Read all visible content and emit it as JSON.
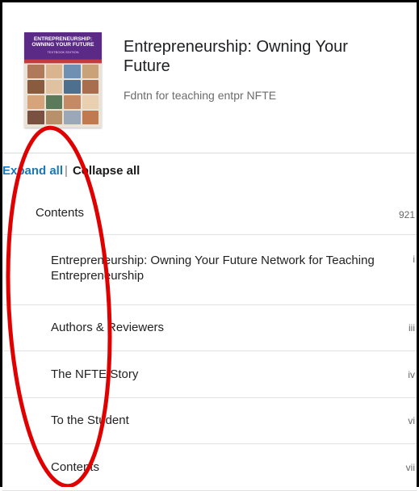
{
  "book": {
    "cover": {
      "title": "ENTREPRENEURSHIP:\nOWNING YOUR FUTURE",
      "subtitle": "TEXTBOOK EDITION",
      "colors": {
        "band": "#5b2a86",
        "stripe": "#c43b3b"
      }
    },
    "title": "Entrepreneurship: Owning Your Future",
    "author": "Fdntn for teaching entpr NFTE"
  },
  "controls": {
    "expand_all": "Expand all",
    "separator": "|",
    "collapse_all": "Collapse all"
  },
  "toc": {
    "header": {
      "label": "Contents",
      "page": "921"
    },
    "items": [
      {
        "label": "Entrepreneurship: Owning Your Future Network for Teaching Entrepreneurship",
        "page": "i"
      },
      {
        "label": "Authors & Reviewers",
        "page": "iii"
      },
      {
        "label": "The NFTE Story",
        "page": "iv"
      },
      {
        "label": "To the Student",
        "page": "vi"
      },
      {
        "label": "Contents",
        "page": "vii"
      }
    ]
  },
  "annotation": {
    "color": "#e00000"
  }
}
